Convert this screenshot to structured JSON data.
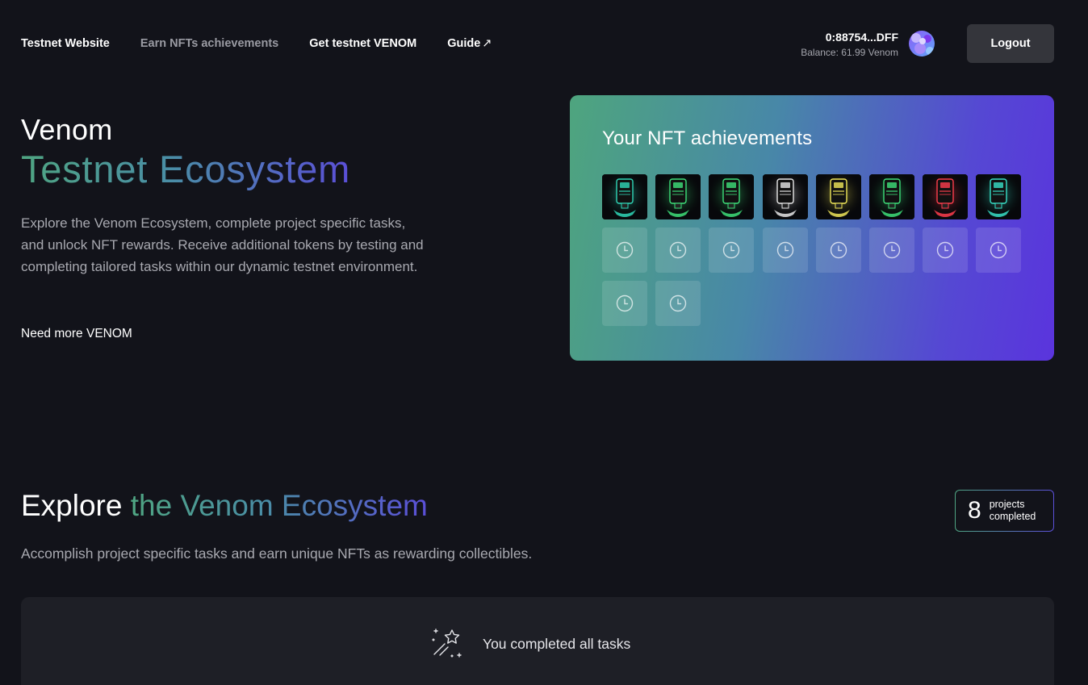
{
  "nav": {
    "items": [
      {
        "label": "Testnet Website",
        "muted": false
      },
      {
        "label": "Earn NFTs achievements",
        "muted": true
      },
      {
        "label": "Get testnet VENOM",
        "muted": false
      },
      {
        "label": "Guide",
        "muted": false,
        "external_arrow": "↗"
      }
    ]
  },
  "account": {
    "address": "0:88754...DFF",
    "balance": "Balance: 61.99 Venom",
    "logout_label": "Logout"
  },
  "hero": {
    "title_line1": "Venom",
    "title_line2": "Testnet Ecosystem",
    "description": "Explore the Venom Ecosystem, complete project specific tasks, and unlock NFT rewards. Receive additional tokens by testing and completing tailored tasks within our dynamic testnet environment.",
    "cta": "Need more VENOM"
  },
  "nft_card": {
    "title": "Your NFT achievements",
    "owned": [
      {
        "icon": "robot-nft-teal",
        "glow": "#2fd7b8"
      },
      {
        "icon": "robot-nft-green",
        "glow": "#3ee07a"
      },
      {
        "icon": "robot-nft-green",
        "glow": "#3ee07a"
      },
      {
        "icon": "robot-nft-white",
        "glow": "#e8e8e8"
      },
      {
        "icon": "robot-nft-yellow",
        "glow": "#f1e85a"
      },
      {
        "icon": "robot-nft-green",
        "glow": "#3ee07a"
      },
      {
        "icon": "robot-nft-red",
        "glow": "#ff3d4d"
      },
      {
        "icon": "robot-nft-cyan",
        "glow": "#38e0c8"
      }
    ],
    "pending_count": 10,
    "pending_icon": "clock-icon"
  },
  "explore": {
    "title_plain": "Explore ",
    "title_gradient": "the Venom Ecosystem",
    "subtitle": "Accomplish project specific tasks and earn unique NFTs as rewarding collectibles.",
    "projects_completed": "8",
    "projects_label_1": "projects",
    "projects_label_2": "completed",
    "tasks_message": "You completed all tasks",
    "tasks_icon": "magic-wand-icon"
  },
  "colors": {
    "background": "#12131a",
    "gradient_start": "#4ea57e",
    "gradient_end": "#5a34dd",
    "panel": "#1e1f26",
    "logout_bg": "#34353b"
  }
}
